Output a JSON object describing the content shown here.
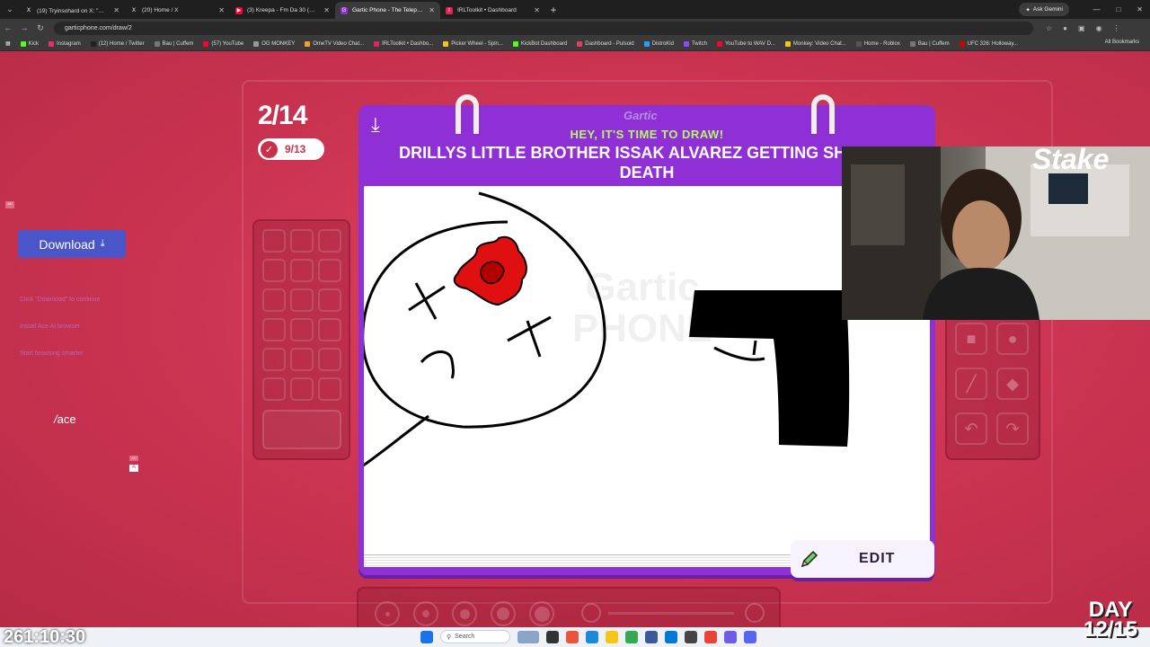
{
  "browser": {
    "tabs": [
      {
        "title": "(19) Tryinsohard on X: \"☠ Cuff",
        "color": "#222222",
        "glyph": "X"
      },
      {
        "title": "(20) Home / X",
        "color": "#222222",
        "glyph": "X"
      },
      {
        "title": "(3) Kreepa - Fm Da 30 (Official",
        "color": "#ff0033",
        "glyph": "▶"
      },
      {
        "title": "Gartic Phone - The Telephone G",
        "color": "#8f2fd6",
        "glyph": "G"
      },
      {
        "title": "IRLToolkit • Dashboard",
        "color": "#e0245e",
        "glyph": "I"
      }
    ],
    "ask_gemini": "Ask Gemini",
    "url": "garticphone.com/draw/2",
    "bookmarks": [
      {
        "label": "Kick",
        "color": "#53fc18"
      },
      {
        "label": "Instagram",
        "color": "#e1306c"
      },
      {
        "label": "(12) Home / Twitter",
        "color": "#222222"
      },
      {
        "label": "Bau | Cuffem",
        "color": "#777777"
      },
      {
        "label": "(57) YouTube",
        "color": "#ff0033"
      },
      {
        "label": "OG MONKEY",
        "color": "#999999"
      },
      {
        "label": "OmeTV Video Chat...",
        "color": "#f0a030"
      },
      {
        "label": "IRLToolkit • Dashbo...",
        "color": "#e0245e"
      },
      {
        "label": "Picker Wheel - Spin...",
        "color": "#f5c518"
      },
      {
        "label": "KickBot Dashboard",
        "color": "#53fc18"
      },
      {
        "label": "Dashboard - Pulsoid",
        "color": "#e04060"
      },
      {
        "label": "DistroKid",
        "color": "#2a9df4"
      },
      {
        "label": "Twitch",
        "color": "#9146ff"
      },
      {
        "label": "YouTube to WAV D...",
        "color": "#ff0033"
      },
      {
        "label": "Monkey: Video Chat...",
        "color": "#f5c518"
      },
      {
        "label": "Home - Roblox",
        "color": "#555555"
      },
      {
        "label": "Bau | Cuffem",
        "color": "#777777"
      },
      {
        "label": "UFC 326: Holloway...",
        "color": "#cc0000"
      }
    ],
    "all_bookmarks": "All Bookmarks"
  },
  "ad": {
    "badge": "AD",
    "download_label": "Download",
    "lines": [
      "Click \"Download\" to continue",
      "Install Ace AI browser",
      "Start browsing smarter"
    ],
    "brand": "ace"
  },
  "game": {
    "round_counter": "2/14",
    "done_count": "9/13",
    "logo": "Gartic",
    "heading": "HEY, IT'S TIME TO DRAW!",
    "prompt": "DRILLYS LITTLE BROTHER ISSAK ALVAREZ GETTING SHOT TO DEATH",
    "watermark": "Gartic PHONE",
    "edit_label": "EDIT",
    "brush_sizes": [
      1,
      2,
      3,
      4,
      5
    ],
    "size_level": 1.0,
    "tools": [
      "square-outline-icon",
      "circle-outline-icon",
      "square-fill-icon",
      "circle-fill-icon",
      "line-icon",
      "bucket-icon",
      "undo-icon",
      "redo-icon"
    ]
  },
  "overlay": {
    "timer": "261:10:30",
    "day_label": "DAY",
    "day_value": "12/15",
    "webcam_sign": "Stake"
  },
  "taskbar": {
    "search": "Search"
  }
}
